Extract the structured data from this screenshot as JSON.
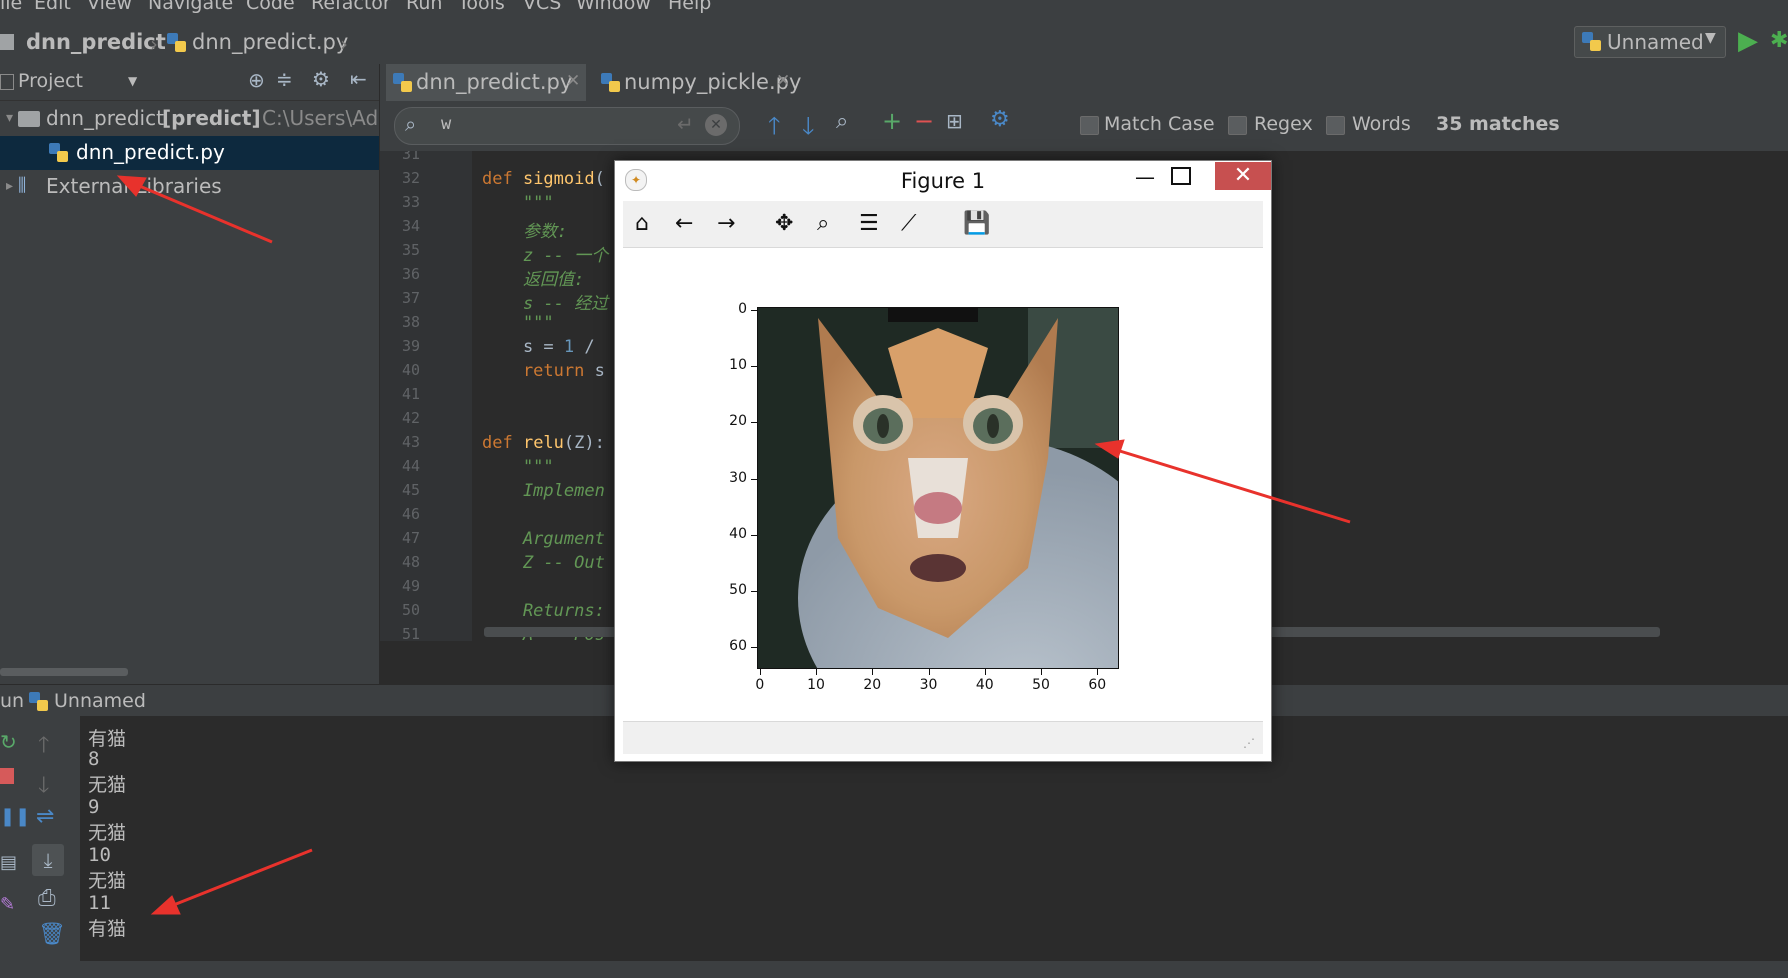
{
  "menu": [
    "ile",
    "Edit",
    "View",
    "Navigate",
    "Code",
    "Refactor",
    "Run",
    "Tools",
    "VCS",
    "Window",
    "Help"
  ],
  "nav": {
    "project": "dnn_predict",
    "file": "dnn_predict.py",
    "run_config": "Unnamed"
  },
  "project_panel": {
    "title": "Project",
    "root_name": "dnn_predict",
    "root_module": "[predict]",
    "root_path": "C:\\Users\\Adr",
    "file": "dnn_predict.py",
    "libraries": "External Libraries"
  },
  "tabs": [
    {
      "label": "dnn_predict.py",
      "active": true
    },
    {
      "label": "numpy_pickle.py",
      "active": false
    }
  ],
  "search": {
    "query": "w",
    "match_case": "Match Case",
    "regex": "Regex",
    "words": "Words",
    "matches": "35 matches"
  },
  "editor": {
    "line_numbers": [
      "31",
      "32",
      "33",
      "34",
      "35",
      "36",
      "37",
      "38",
      "39",
      "40",
      "41",
      "42",
      "43",
      "44",
      "45",
      "46",
      "47",
      "48",
      "49",
      "50",
      "51"
    ],
    "lines": [
      {
        "parts": []
      },
      {
        "parts": [
          {
            "c": "kw",
            "t": "def "
          },
          {
            "c": "fn",
            "t": "sigmoid"
          },
          {
            "c": "plain",
            "t": "("
          }
        ]
      },
      {
        "parts": [
          {
            "c": "doc",
            "t": "    \"\"\""
          }
        ]
      },
      {
        "parts": [
          {
            "c": "doc",
            "t": "    参数:"
          }
        ]
      },
      {
        "parts": [
          {
            "c": "doc",
            "t": "    z -- 一个"
          }
        ]
      },
      {
        "parts": [
          {
            "c": "doc",
            "t": "    返回值:"
          }
        ]
      },
      {
        "parts": [
          {
            "c": "doc",
            "t": "    s -- 经过"
          }
        ]
      },
      {
        "parts": [
          {
            "c": "doc",
            "t": "    \"\"\""
          }
        ]
      },
      {
        "parts": [
          {
            "c": "plain",
            "t": "    s = "
          },
          {
            "c": "num",
            "t": "1"
          },
          {
            "c": "plain",
            "t": " /"
          }
        ]
      },
      {
        "parts": [
          {
            "c": "kw",
            "t": "    return"
          },
          {
            "c": "plain",
            "t": " s"
          }
        ]
      },
      {
        "parts": []
      },
      {
        "parts": []
      },
      {
        "parts": [
          {
            "c": "kw",
            "t": "def "
          },
          {
            "c": "fn",
            "t": "relu"
          },
          {
            "c": "plain",
            "t": "(Z):"
          }
        ]
      },
      {
        "parts": [
          {
            "c": "doc",
            "t": "    \"\"\""
          }
        ]
      },
      {
        "parts": [
          {
            "c": "doc",
            "t": "    Implemen"
          }
        ]
      },
      {
        "parts": []
      },
      {
        "parts": [
          {
            "c": "doc",
            "t": "    Argument"
          }
        ]
      },
      {
        "parts": [
          {
            "c": "doc",
            "t": "    Z -- Out"
          }
        ]
      },
      {
        "parts": []
      },
      {
        "parts": [
          {
            "c": "doc",
            "t": "    Returns:"
          }
        ]
      },
      {
        "parts": [
          {
            "c": "doc",
            "t": "    A -- Pos"
          }
        ]
      }
    ]
  },
  "run_panel": {
    "label": "un",
    "config": "Unnamed",
    "output": [
      "有猫",
      "8",
      "无猫",
      "9",
      "无猫",
      "10",
      "无猫",
      "11",
      "有猫"
    ]
  },
  "figure": {
    "title": "Figure 1",
    "x_ticks": [
      "0",
      "10",
      "20",
      "30",
      "40",
      "50",
      "60"
    ],
    "y_ticks": [
      "0",
      "10",
      "20",
      "30",
      "40",
      "50",
      "60"
    ],
    "image_description_icon": "cat-image"
  },
  "colors": {
    "arrow": "#e8322c",
    "accent_selected": "#0d293e",
    "keyword": "#cc7832",
    "function": "#ffc66d",
    "docstring": "#629755"
  }
}
